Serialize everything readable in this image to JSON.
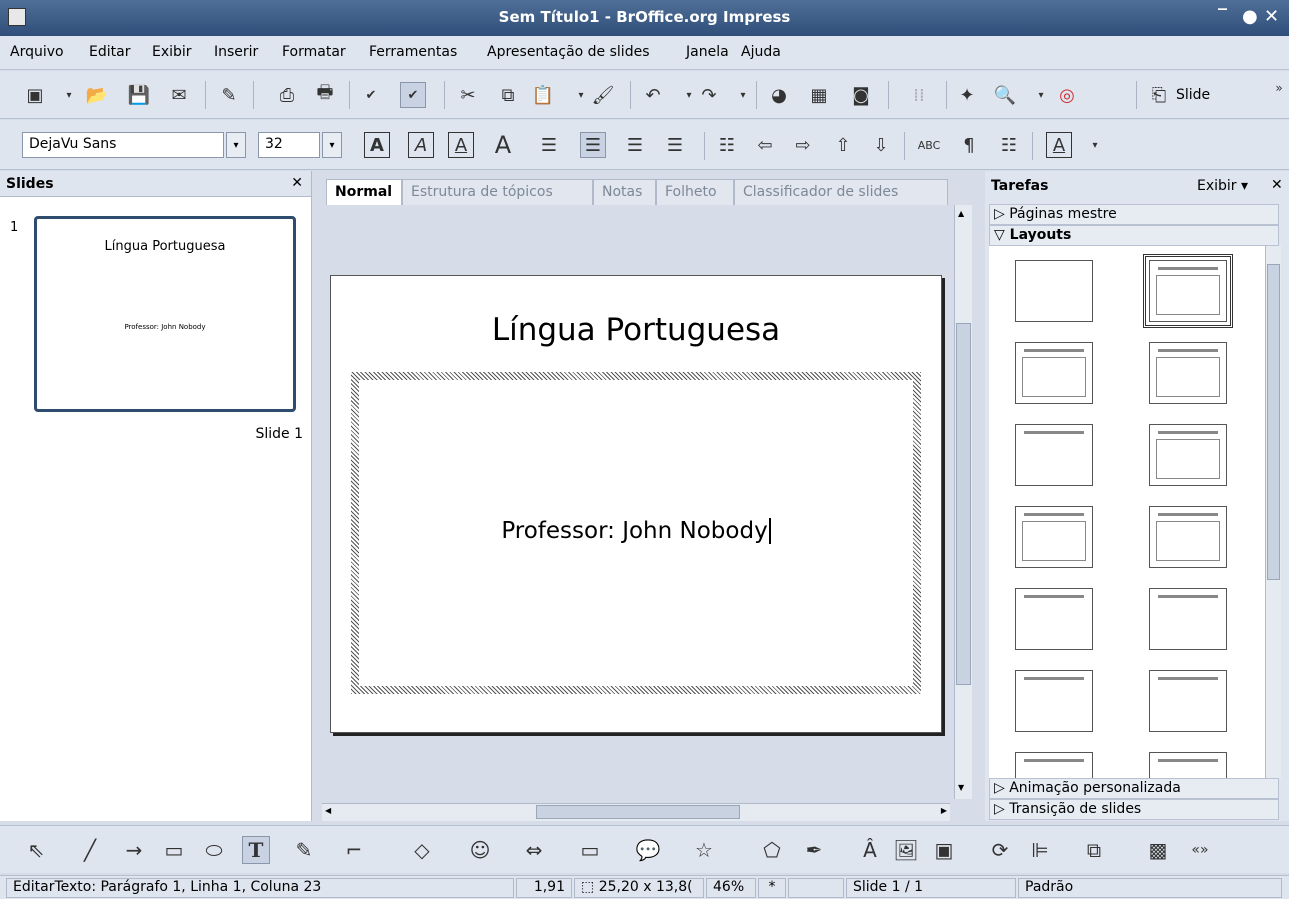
{
  "window": {
    "title": "Sem Título1 - BrOffice.org Impress"
  },
  "menu": [
    "Arquivo",
    "Editar",
    "Exibir",
    "Inserir",
    "Formatar",
    "Ferramentas",
    "Apresentação de slides",
    "Janela",
    "Ajuda"
  ],
  "toolbar": {
    "slide_label": "Slide",
    "font_name": "DejaVu Sans",
    "font_size": "32"
  },
  "slides_panel": {
    "title": "Slides",
    "thumb_number": "1",
    "thumb_title": "Língua Portuguesa",
    "thumb_subtitle": "Professor: John Nobody",
    "thumb_caption": "Slide 1"
  },
  "tabs": [
    "Normal",
    "Estrutura de tópicos",
    "Notas",
    "Folheto",
    "Classificador de slides"
  ],
  "slide": {
    "title": "Língua Portuguesa",
    "body": "Professor: John Nobody"
  },
  "tasks": {
    "title": "Tarefas",
    "view_label": "Exibir",
    "sections": {
      "master": "Páginas mestre",
      "layouts": "Layouts",
      "animation": "Animação personalizada",
      "transition": "Transição de slides"
    }
  },
  "status": {
    "mode": "EditarTexto: Parágrafo 1, Linha 1, Coluna 23",
    "position": "1,91",
    "size": "25,20 x 13,8(",
    "zoom": "46%",
    "modified": "*",
    "slide": "Slide 1 / 1",
    "style": "Padrão"
  },
  "colors": {
    "title_bar": "#3d5e8a",
    "thumb_border": "#2e4c6d",
    "panel_bg": "#dfe5ef"
  }
}
